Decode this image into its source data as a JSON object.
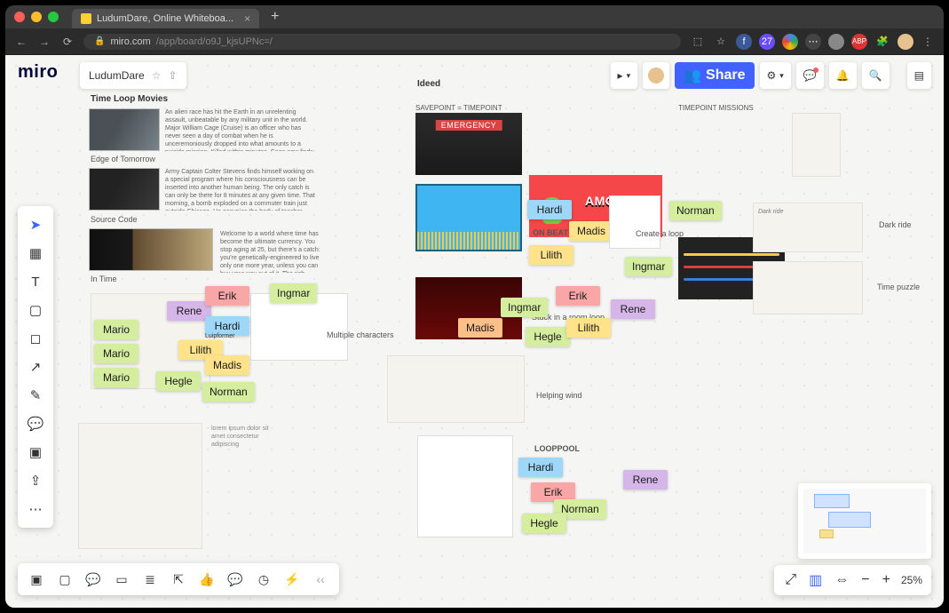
{
  "browser": {
    "tab_title": "LudumDare, Online Whiteboa...",
    "url_host": "miro.com",
    "url_path": "/app/board/o9J_kjsUPNc=/"
  },
  "miro": {
    "logo": "miro",
    "board_name": "LudumDare",
    "share": "Share",
    "zoom": {
      "value": "25%"
    }
  },
  "sections": {
    "movies_title": "Time Loop Movies",
    "movie1": "Edge of Tomorrow",
    "movie2": "Source Code",
    "movie3": "In Time",
    "ideed": "Ideed",
    "savepoint": "SAVEPOINT = TIMEPOINT",
    "timepoint": "TIMEPOINT MISSIONS",
    "onbeat": "ON BEAT",
    "createloop": "Create a loop",
    "stuck": "Stuck in a room loop",
    "multchars": "Multiple characters",
    "helpingwind": "Helping wind",
    "looppool": "LOOPPOOL",
    "darkride": "Dark ride",
    "timepuzzle": "Time puzzle",
    "luipformer": "Luipformer",
    "darkride_sk": "Dark ride"
  },
  "stickies": {
    "a": [
      "Mario",
      "Mario",
      "Mario"
    ],
    "rene": "Rene",
    "erik": "Erik",
    "ingmar": "Ingmar",
    "hardi": "Hardi",
    "lilith": "Lilith",
    "madis": "Madis",
    "hegle": "Hegle",
    "norman": "Norman"
  },
  "movie_texts": {
    "t1": "An alien race has hit the Earth in an unrelenting assault, unbeatable by any military unit in the world. Major William Cage (Cruise) is an officer who has never seen a day of combat when he is unceremoniously dropped into what amounts to a suicide mission. Killed within minutes, Cage now finds himself inexplicably thrown into a time loop-forcing him to live out the same brutal combat over and over, fighting and dying again... and again. But with each battle, Cage becomes able to engage the adversaries with increasing skill, alongside Special Forces warrior Rita Vrataski (Blunt). And, as Cage and Vrataski take the fight to the aliens, each repeated encounter gets them one step closer to defeating the enemy!",
    "t2": "Army Captain Colter Stevens finds himself working on a special program where his consciousness can be inserted into another human being. The only catch is can only be there for 8 minutes at any given time. That morning, a bomb exploded on a commuter train just outside Chicago. He occupies the body of teacher going to work on that train and is confused as to what he is doing or why he is there as his last memory is flying his helicopter on a combat mission in Afghanistan.",
    "t3": "Welcome to a world where time has become the ultimate currency. You stop aging at 25, but there's a catch: you're genetically-engineered to live only one more year, unless you can buy your way out of it. The rich \"earn\" decades at a time (remaining at age 25), becoming essentially immortal, while the rest beg, borrow or steal enough hours to make it through the day. When a man from the wrong side of the tracks is falsely accused of murder, he is forced to go on the run with a beautiful hostage. Living minute to minute, the duo's love becomes a powerful tool in their war against the system."
  }
}
